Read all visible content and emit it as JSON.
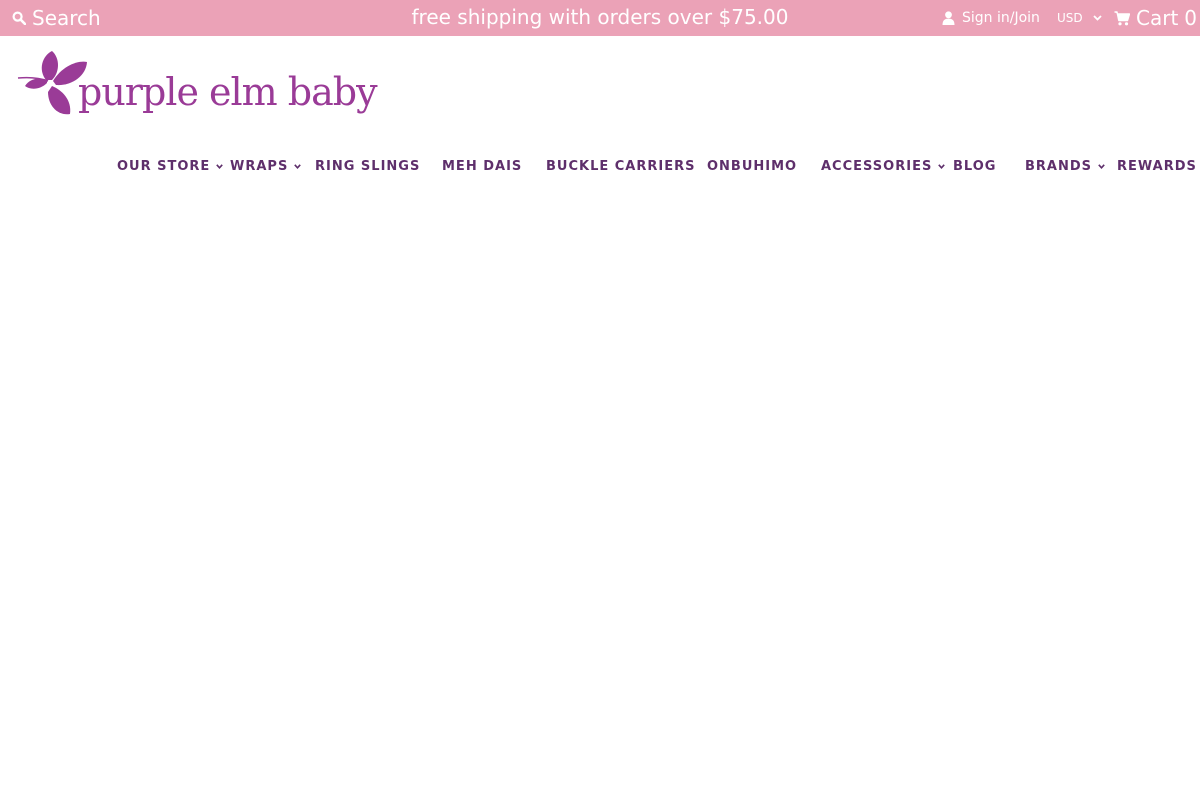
{
  "topbar": {
    "search_label": "Search",
    "announcement": "free shipping with orders over $75.00",
    "account_label": "Sign in/Join",
    "currency_selected": "USD",
    "cart_label": "Cart",
    "cart_count": "0"
  },
  "logo": {
    "text": "purple elm baby"
  },
  "nav": {
    "items": [
      {
        "label": "OUR STORE",
        "has_dropdown": true
      },
      {
        "label": "WRAPS",
        "has_dropdown": true
      },
      {
        "label": "RING SLINGS",
        "has_dropdown": false
      },
      {
        "label": "MEH DAIS",
        "has_dropdown": false
      },
      {
        "label": "BUCKLE CARRIERS",
        "has_dropdown": false
      },
      {
        "label": "ONBUHIMO",
        "has_dropdown": false
      },
      {
        "label": "ACCESSORIES",
        "has_dropdown": true
      },
      {
        "label": "BLOG",
        "has_dropdown": false
      },
      {
        "label": "BRANDS",
        "has_dropdown": true
      },
      {
        "label": "REWARDS",
        "has_dropdown": false
      }
    ]
  },
  "colors": {
    "topbar_bg": "#eba2b7",
    "brand_purple": "#9a3b97",
    "nav_text": "#5e2f6b",
    "page_bg": "#ffffff"
  },
  "icons": {
    "search": "search-icon",
    "account": "user-icon",
    "currency": "chevron-down-icon",
    "cart": "cart-icon",
    "logo": "leaf-logo-icon"
  }
}
